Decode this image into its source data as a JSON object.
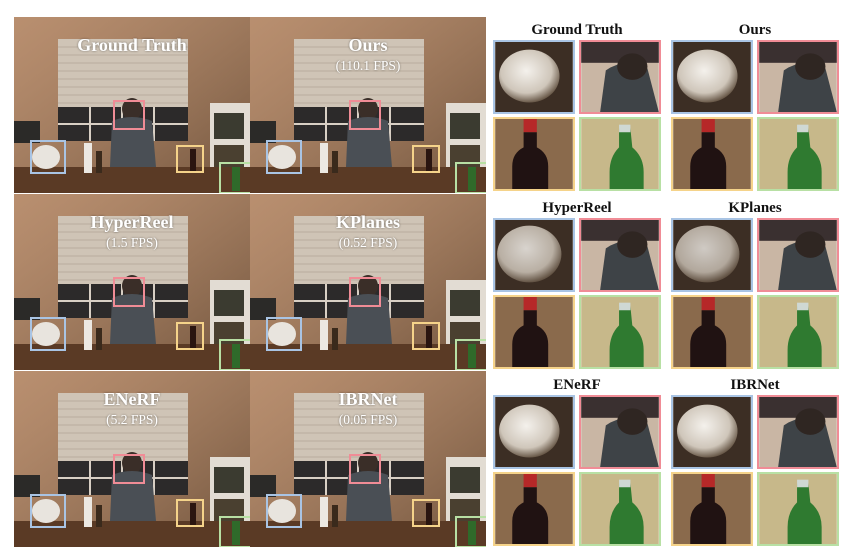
{
  "scenes": [
    {
      "name": "Ground Truth",
      "fps": ""
    },
    {
      "name": "Ours",
      "fps": "(110.1 FPS)"
    },
    {
      "name": "HyperReel",
      "fps": "(1.5 FPS)"
    },
    {
      "name": "KPlanes",
      "fps": "(0.52 FPS)"
    },
    {
      "name": "ENeRF",
      "fps": "(5.2 FPS)"
    },
    {
      "name": "IBRNet",
      "fps": "(0.05 FPS)"
    }
  ],
  "crop_panels": [
    {
      "title": "Ground Truth"
    },
    {
      "title": "Ours"
    },
    {
      "title": "HyperReel"
    },
    {
      "title": "KPlanes"
    },
    {
      "title": "ENeRF"
    },
    {
      "title": "IBRNet"
    }
  ],
  "colors": {
    "box_red": "#f08c96",
    "box_blue": "#a9c4e4",
    "box_yellow": "#f5d38a",
    "box_green": "#b8e0a4"
  }
}
